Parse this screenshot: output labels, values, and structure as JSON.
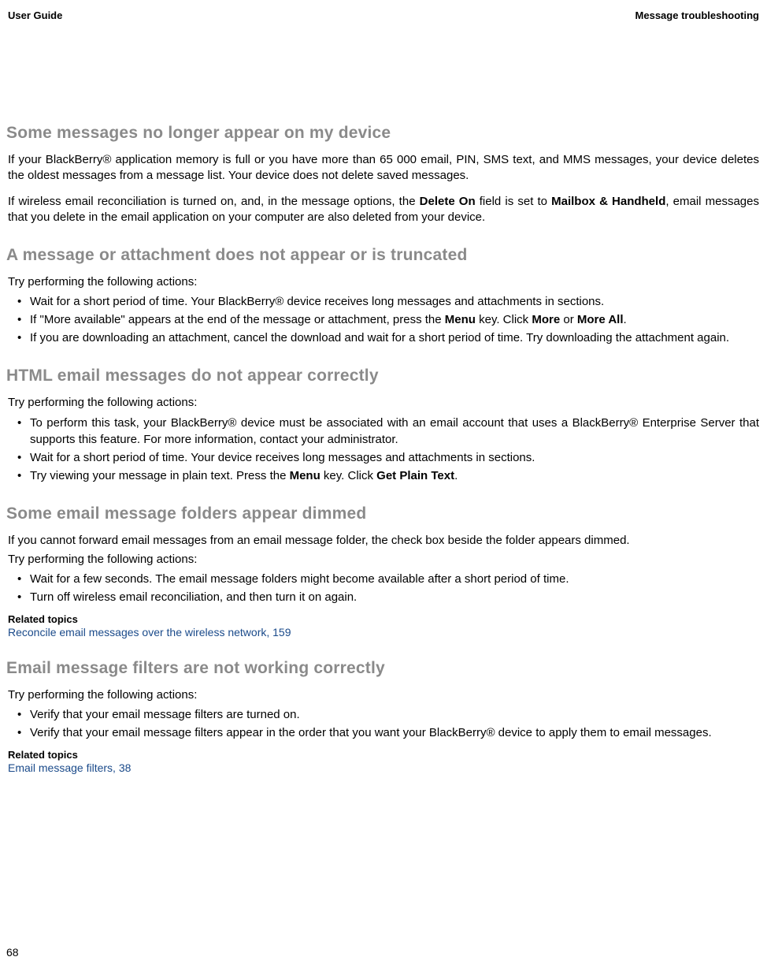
{
  "header": {
    "left": "User Guide",
    "right": "Message troubleshooting"
  },
  "page_number": "68",
  "sections": {
    "s1": {
      "heading": "Some messages no longer appear on my device",
      "p1_pre": "If your BlackBerry® application memory is full or you have more than 65 000 email, PIN, SMS text, and MMS messages, your device deletes the oldest messages from a message list. Your device does not delete saved messages.",
      "p2_a": "If wireless email reconciliation is turned on, and, in the message options, the ",
      "p2_b": "Delete On",
      "p2_c": " field is set to ",
      "p2_d": "Mailbox & Handheld",
      "p2_e": ", email messages that you delete in the email application on your computer are also deleted from your device."
    },
    "s2": {
      "heading": "A message or attachment does not appear or is truncated",
      "intro": "Try performing the following actions:",
      "b1": "Wait for a short period of time. Your BlackBerry® device receives long messages and attachments in sections.",
      "b2_a": "If \"More available\" appears at the end of the message or attachment, press the ",
      "b2_b": "Menu",
      "b2_c": " key. Click ",
      "b2_d": "More",
      "b2_e": " or ",
      "b2_f": "More All",
      "b2_g": ".",
      "b3": "If you are downloading an attachment, cancel the download and wait for a short period of time. Try downloading the attachment again."
    },
    "s3": {
      "heading": "HTML email messages do not appear correctly",
      "intro": "Try performing the following actions:",
      "b1": "To perform this task, your BlackBerry® device must be associated with an email account that uses a BlackBerry® Enterprise Server that supports this feature. For more information, contact your administrator.",
      "b2": "Wait for a short period of time. Your device receives long messages and attachments in sections.",
      "b3_a": "Try viewing your message in plain text. Press the ",
      "b3_b": "Menu",
      "b3_c": " key. Click ",
      "b3_d": "Get Plain Text",
      "b3_e": "."
    },
    "s4": {
      "heading": "Some email message folders appear dimmed",
      "p1": "If you cannot forward email messages from an email message folder, the check box beside the folder appears dimmed.",
      "intro": "Try performing the following actions:",
      "b1": "Wait for a few seconds. The email message folders might become available after a short period of time.",
      "b2": "Turn off wireless email reconciliation, and then turn it on again.",
      "related_label": "Related topics",
      "related_link": "Reconcile email messages over the wireless network, 159"
    },
    "s5": {
      "heading": "Email message filters are not working correctly",
      "intro": "Try performing the following actions:",
      "b1": "Verify that your email message filters are turned on.",
      "b2": "Verify that your email message filters appear in the order that you want your BlackBerry® device to apply them to email messages.",
      "related_label": "Related topics",
      "related_link": "Email message filters, 38"
    }
  }
}
